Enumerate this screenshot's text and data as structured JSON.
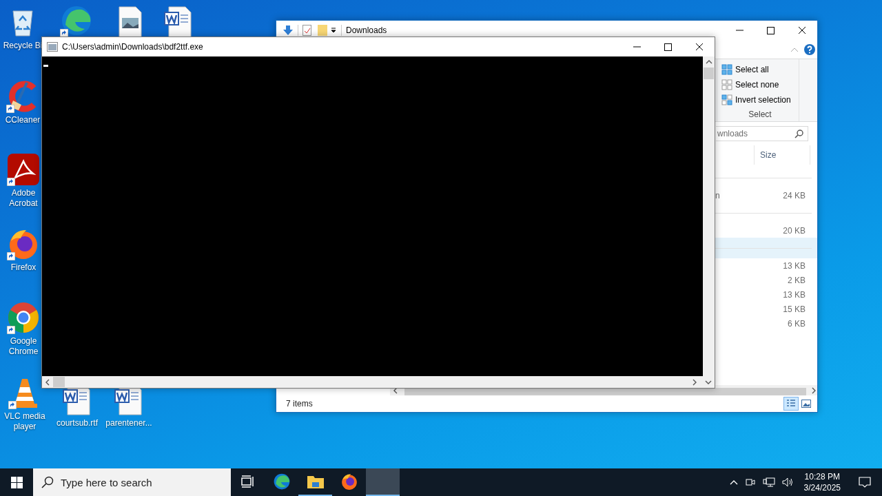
{
  "desktop_icons": [
    {
      "kind": "recycle",
      "label": "Recycle Bi",
      "shortcut": false
    },
    {
      "kind": "edge",
      "shortcut": true
    },
    {
      "kind": "image",
      "shortcut": false
    },
    {
      "kind": "word",
      "shortcut": false
    },
    {
      "kind": "ccleaner",
      "label": "CCleaner",
      "shortcut": true
    },
    {
      "kind": "acrobat",
      "label": "Adobe Acrobat",
      "shortcut": true
    },
    {
      "kind": "firefox",
      "label": "Firefox",
      "shortcut": true
    },
    {
      "kind": "chrome",
      "label": "Google Chrome",
      "shortcut": true
    },
    {
      "kind": "vlc",
      "label": "VLC media player",
      "shortcut": true
    },
    {
      "kind": "word",
      "label": "courtsub.rtf",
      "shortcut": false
    },
    {
      "kind": "word",
      "label": "parentener...",
      "shortcut": false
    }
  ],
  "explorer": {
    "title": "Downloads",
    "ribbon": {
      "items": [
        {
          "kind": "all",
          "label": "Select all"
        },
        {
          "kind": "none",
          "label": "Select none"
        },
        {
          "kind": "invert",
          "label": "Invert selection"
        }
      ],
      "group_label": "Select"
    },
    "search": {
      "value": "wnloads"
    },
    "columns": [
      "Size"
    ],
    "rows": [
      {
        "kind": "group",
        "selected": false
      },
      {
        "kind": "file",
        "name": "n",
        "size": "24 KB"
      },
      {
        "kind": "group",
        "selected": false
      },
      {
        "kind": "file",
        "size": "20 KB"
      },
      {
        "kind": "group",
        "selected": true
      },
      {
        "kind": "file",
        "size": "13 KB"
      },
      {
        "kind": "file",
        "size": "2 KB"
      },
      {
        "kind": "file",
        "size": "13 KB"
      },
      {
        "kind": "file",
        "size": "15 KB"
      },
      {
        "kind": "file",
        "size": "6 KB"
      }
    ],
    "status": "7 items",
    "views": [
      {
        "kind": "details",
        "selected": true
      },
      {
        "kind": "icons",
        "selected": false
      }
    ]
  },
  "console": {
    "title": "C:\\Users\\admin\\Downloads\\bdf2ttf.exe"
  },
  "taskbar": {
    "search_placeholder": "Type here to search",
    "apps": [
      {
        "kind": "taskview",
        "running": false,
        "selected": false
      },
      {
        "kind": "edge",
        "running": false,
        "selected": false
      },
      {
        "kind": "explorer",
        "running": true,
        "selected": false
      },
      {
        "kind": "firefox",
        "running": false,
        "selected": false
      },
      {
        "kind": "console",
        "running": true,
        "selected": true
      }
    ],
    "time": "10:28 PM",
    "date": "3/24/2025"
  }
}
